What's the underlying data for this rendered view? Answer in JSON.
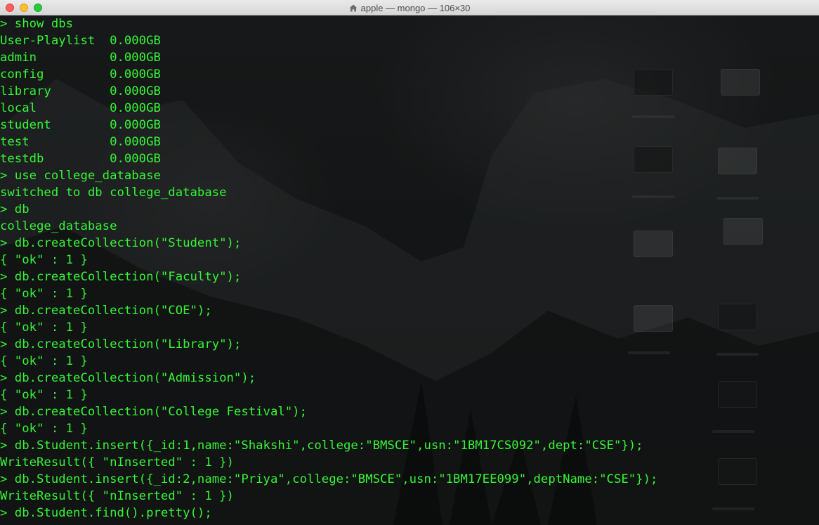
{
  "window": {
    "title": "apple — mongo — 106×30",
    "title_icon": "home-icon",
    "traffic_lights": {
      "close_color": "#fe5f57",
      "minimize_color": "#febc2e",
      "zoom_color": "#28c840"
    }
  },
  "terminal": {
    "text_color": "#35f535",
    "lines": [
      "> show dbs",
      "User-Playlist  0.000GB",
      "admin          0.000GB",
      "config         0.000GB",
      "library        0.000GB",
      "local          0.000GB",
      "student        0.000GB",
      "test           0.000GB",
      "testdb         0.000GB",
      "> use college_database",
      "switched to db college_database",
      "> db",
      "college_database",
      "> db.createCollection(\"Student\");",
      "{ \"ok\" : 1 }",
      "> db.createCollection(\"Faculty\");",
      "{ \"ok\" : 1 }",
      "> db.createCollection(\"COE\");",
      "{ \"ok\" : 1 }",
      "> db.createCollection(\"Library\");",
      "{ \"ok\" : 1 }",
      "> db.createCollection(\"Admission\");",
      "{ \"ok\" : 1 }",
      "> db.createCollection(\"College Festival\");",
      "{ \"ok\" : 1 }",
      "> db.Student.insert({_id:1,name:\"Shakshi\",college:\"BMSCE\",usn:\"1BM17CS092\",dept:\"CSE\"});",
      "WriteResult({ \"nInserted\" : 1 })",
      "> db.Student.insert({_id:2,name:\"Priya\",college:\"BMSCE\",usn:\"1BM17EE099\",deptName:\"CSE\"});",
      "WriteResult({ \"nInserted\" : 1 })",
      "> db.Student.find().pretty();"
    ]
  }
}
